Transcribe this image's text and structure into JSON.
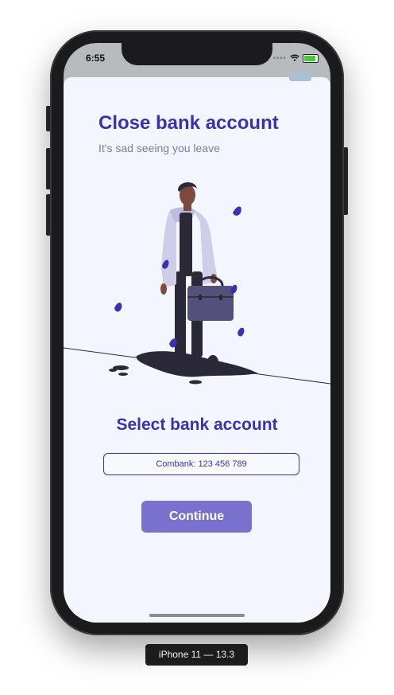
{
  "status_bar": {
    "time": "6:55",
    "icons": [
      "cellular-dots-icon",
      "wifi-icon",
      "battery-charging-icon"
    ]
  },
  "header": {
    "title": "Close bank account",
    "subtitle": "It's sad seeing you leave"
  },
  "illustration": {
    "icon": "man-with-briefcase-illustration"
  },
  "account_section": {
    "title": "Select bank account",
    "selected_account": "Combank: 123 456 789"
  },
  "actions": {
    "continue_label": "Continue"
  },
  "device": {
    "label": "iPhone 11 — 13.3"
  },
  "colors": {
    "accent": "#3d2fb4",
    "button": "#7a70cd",
    "background": "#f4f6fd",
    "subtitle": "#7d7f95"
  }
}
